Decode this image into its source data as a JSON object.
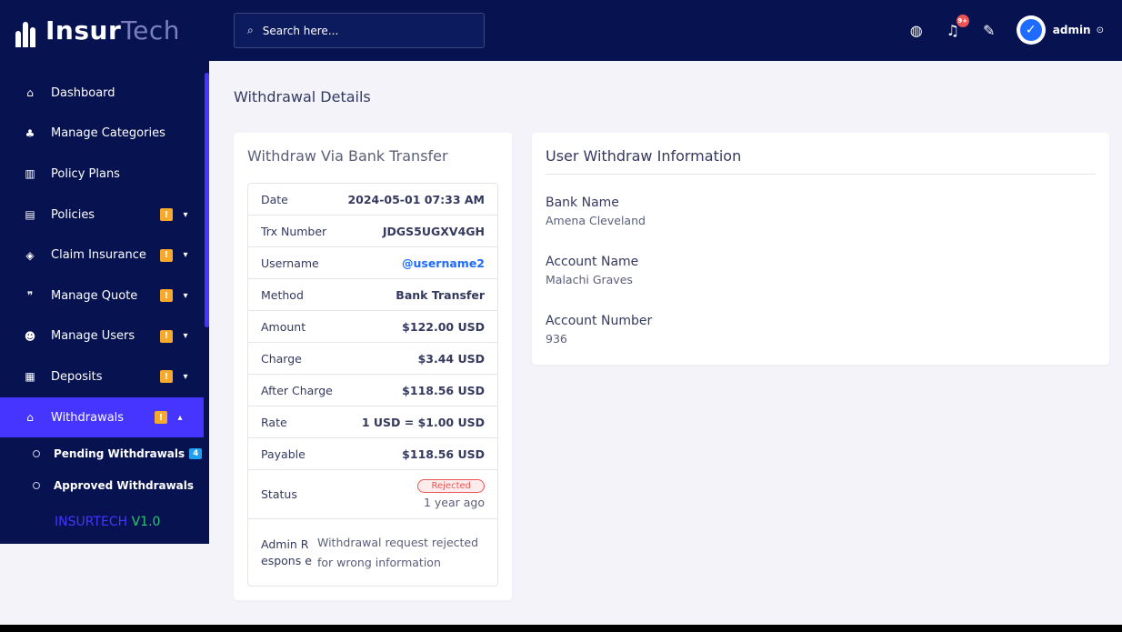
{
  "brand": {
    "bold": "Insur",
    "light": "Tech"
  },
  "search": {
    "placeholder": "Search here..."
  },
  "topbar": {
    "notify_count": "9+",
    "user_name": "admin"
  },
  "sidebar": {
    "items": [
      {
        "label": "Dashboard",
        "icon": "home-icon"
      },
      {
        "label": "Manage Categories",
        "icon": "tree-icon"
      },
      {
        "label": "Policy Plans",
        "icon": "chart-icon"
      },
      {
        "label": "Policies",
        "icon": "document-icon",
        "badge": "!"
      },
      {
        "label": "Claim Insurance",
        "icon": "shield-icon",
        "badge": "!"
      },
      {
        "label": "Manage Quote",
        "icon": "quote-icon",
        "badge": "!"
      },
      {
        "label": "Manage Users",
        "icon": "users-icon",
        "badge": "!"
      },
      {
        "label": "Deposits",
        "icon": "deposit-icon",
        "badge": "!"
      },
      {
        "label": "Withdrawals",
        "icon": "bank-icon",
        "badge": "!"
      }
    ],
    "submenu": [
      {
        "label": "Pending Withdrawals",
        "badge": "4"
      },
      {
        "label": "Approved Withdrawals"
      }
    ],
    "footer_a": "INSURTECH",
    "footer_b": "V1.0"
  },
  "page_title": "Withdrawal Details",
  "withdraw_card": {
    "title": "Withdraw Via Bank Transfer",
    "rows": [
      {
        "label": "Date",
        "value": "2024-05-01 07:33 AM"
      },
      {
        "label": "Trx Number",
        "value": "JDGS5UGXV4GH"
      },
      {
        "label": "Username",
        "value": "@username2"
      },
      {
        "label": "Method",
        "value": "Bank Transfer"
      },
      {
        "label": "Amount",
        "value": "$122.00 USD"
      },
      {
        "label": "Charge",
        "value": "$3.44 USD"
      },
      {
        "label": "After Charge",
        "value": "$118.56 USD"
      },
      {
        "label": "Rate",
        "value": "1 USD = $1.00 USD"
      },
      {
        "label": "Payable",
        "value": "$118.56 USD"
      }
    ],
    "status_label": "Status",
    "status_value": "Rejected",
    "status_time": "1 year ago",
    "admin_label": "Admin Respons e",
    "admin_value": "Withdrawal request rejected for wrong information"
  },
  "user_card": {
    "title": "User Withdraw Information",
    "fields": [
      {
        "label": "Bank Name",
        "value": "Amena Cleveland"
      },
      {
        "label": "Account Name",
        "value": "Malachi Graves"
      },
      {
        "label": "Account Number",
        "value": "936"
      }
    ]
  },
  "colors": {
    "sidebar_bg": "#071251",
    "accent": "#4634ff",
    "warning": "#f7a92b",
    "danger": "#ea5455",
    "link": "#1e6bff"
  }
}
